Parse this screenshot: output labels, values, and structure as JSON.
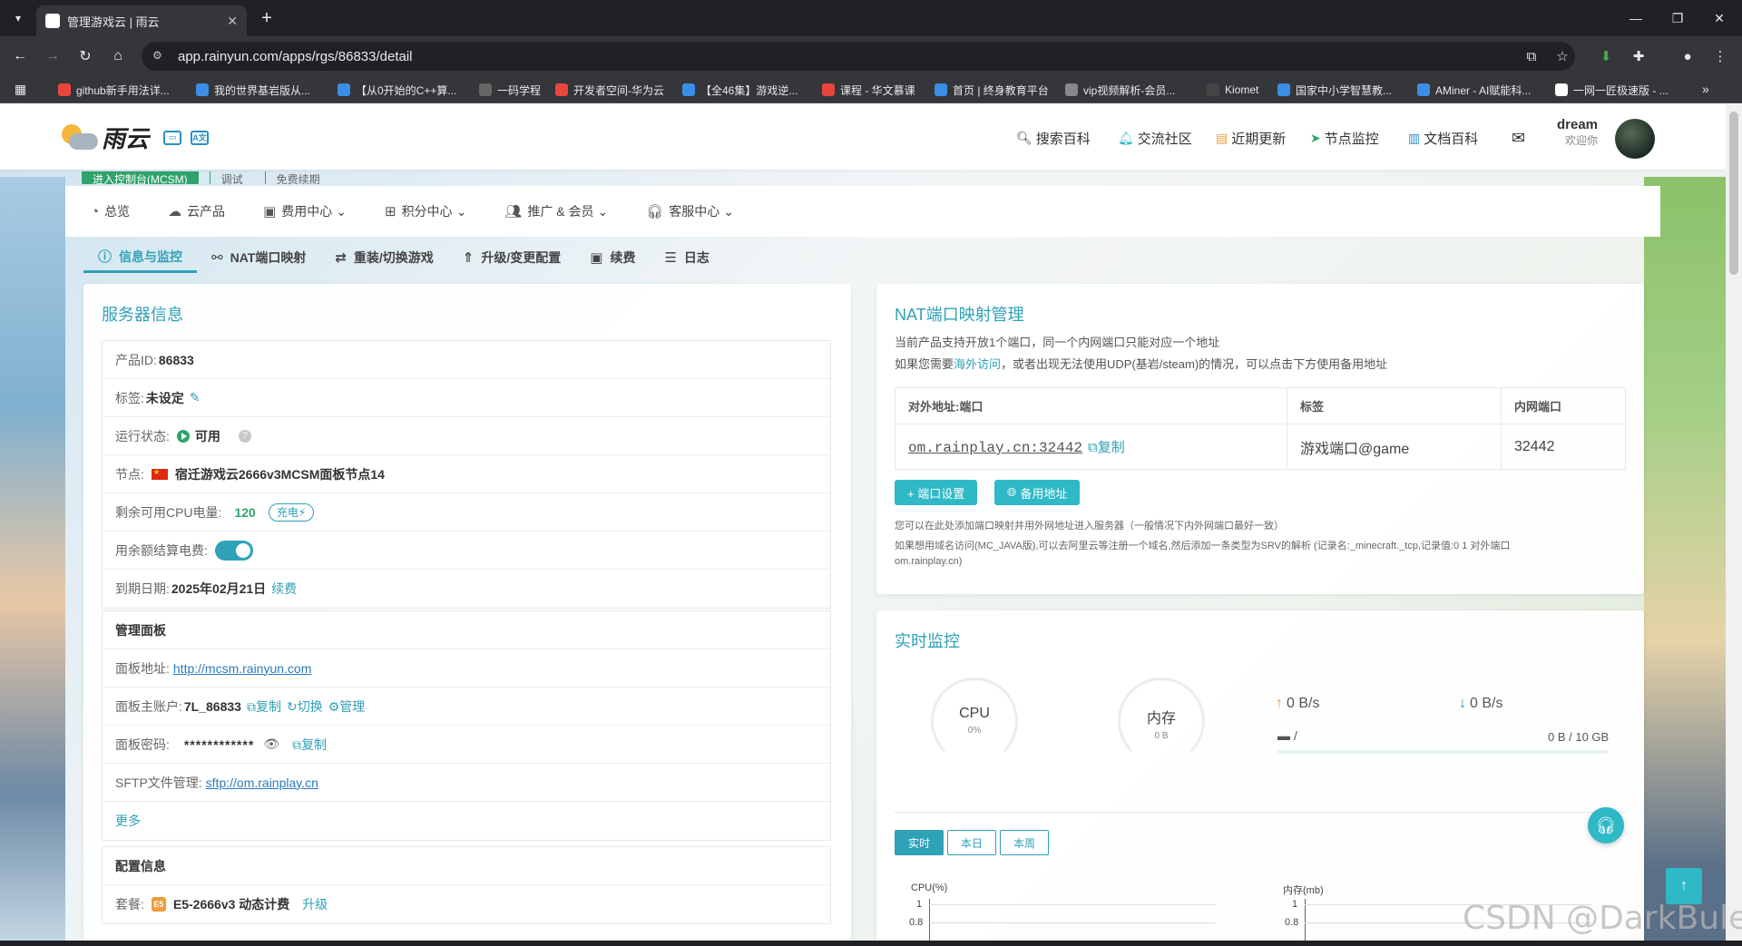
{
  "browser": {
    "tab_title": "管理游戏云 | 雨云",
    "url": "app.rainyun.com/apps/rgs/86833/detail",
    "bookmarks": [
      {
        "label": "github新手用法详...",
        "color": "#e8453c"
      },
      {
        "label": "我的世界基岩版从...",
        "color": "#3b8ee6"
      },
      {
        "label": "【从0开始的C++算...",
        "color": "#3b8ee6"
      },
      {
        "label": "一码学程",
        "color": "#666"
      },
      {
        "label": "开发者空间-华为云",
        "color": "#e8453c"
      },
      {
        "label": "【全46集】游戏逆...",
        "color": "#3b8ee6"
      },
      {
        "label": "课程 - 华文慕课",
        "color": "#e8453c"
      },
      {
        "label": "首页 | 终身教育平台",
        "color": "#3b8ee6"
      },
      {
        "label": "vip视频解析-会员...",
        "color": "#888"
      },
      {
        "label": "Kiomet",
        "color": "#444"
      },
      {
        "label": "国家中小学智慧教...",
        "color": "#3b8ee6"
      },
      {
        "label": "AMiner - AI赋能科...",
        "color": "#3b8ee6"
      },
      {
        "label": "一网一匠极速版 - ...",
        "color": "#fff"
      }
    ]
  },
  "header": {
    "brand": "雨云",
    "nav": [
      {
        "icon": "search-icon",
        "label": "搜索百科"
      },
      {
        "icon": "bell-icon",
        "label": "交流社区"
      },
      {
        "icon": "calendar-icon",
        "label": "近期更新"
      },
      {
        "icon": "send-icon",
        "label": "节点监控"
      },
      {
        "icon": "book-icon",
        "label": "文档百科"
      }
    ],
    "user_name": "dream",
    "user_greeting": "欢迎你"
  },
  "hidden_tabs": {
    "console": "进入控制台(MCSM)",
    "debug": "调试",
    "free_renew": "免费续期"
  },
  "subnav": [
    {
      "icon": "dashboard-icon",
      "label": "总览"
    },
    {
      "icon": "cloud-icon",
      "label": "云产品"
    },
    {
      "icon": "wallet-icon",
      "label": "费用中心"
    },
    {
      "icon": "gift-icon",
      "label": "积分中心"
    },
    {
      "icon": "users-icon",
      "label": "推广 & 会员"
    },
    {
      "icon": "headset-icon",
      "label": "客服中心"
    }
  ],
  "page_tabs": [
    {
      "label": "信息与监控",
      "active": true
    },
    {
      "label": "NAT端口映射"
    },
    {
      "label": "重装/切换游戏"
    },
    {
      "label": "升级/变更配置"
    },
    {
      "label": "续费"
    },
    {
      "label": "日志"
    }
  ],
  "server_info": {
    "title": "服务器信息",
    "product_id_label": "产品ID:",
    "product_id": "86833",
    "tag_label": "标签:",
    "tag": "未设定",
    "status_label": "运行状态:",
    "status": "可用",
    "node_label": "节点:",
    "node": "宿迁游戏云2666v3MCSM面板节点14",
    "cpu_label": "剩余可用CPU电量:",
    "cpu_value": "120",
    "charge": "充电",
    "balance_label": "用余额结算电费:",
    "balance_enabled": true,
    "expire_label": "到期日期:",
    "expire": "2025年02月21日",
    "renew": "续费"
  },
  "panel": {
    "title": "管理面板",
    "url_label": "面板地址:",
    "url": "http://mcsm.rainyun.com",
    "account_label": "面板主账户:",
    "account": "7L_86833",
    "copy": "复制",
    "switch": "切换",
    "manage": "管理",
    "password_label": "面板密码:",
    "password": "************",
    "sftp_label": "SFTP文件管理:",
    "sftp": "sftp://om.rainplay.cn",
    "more": "更多"
  },
  "config": {
    "title": "配置信息",
    "plan_label": "套餐:",
    "plan": "E5-2666v3 动态计费",
    "upgrade": "升级"
  },
  "nat": {
    "title": "NAT端口映射管理",
    "desc1": "当前产品支持开放1个端口，同一个内网端口只能对应一个地址",
    "desc2_pre": "如果您需要",
    "desc2_link": "海外访问",
    "desc2_post": "，或者出现无法使用UDP(基岩/steam)的情况，可以点击下方使用备用地址",
    "headers": [
      "对外地址:端口",
      "标签",
      "内网端口"
    ],
    "rows": [
      {
        "address": "om.rainplay.cn:32442",
        "copy": "复制",
        "tag": "游戏端口@game",
        "port": "32442"
      }
    ],
    "port_settings": "+ 端口设置",
    "backup_address": "备用地址",
    "note1": "您可以在此处添加端口映射并用外网地址进入服务器（一般情况下内外网端口最好一致）",
    "note2": "如果想用域名访问(MC_JAVA版),可以去阿里云等注册一个域名,然后添加一条类型为SRV的解析 (记录名:_minecraft._tcp,记录值:0 1 对外端口",
    "note3": "om.rainplay.cn)"
  },
  "monitor": {
    "title": "实时监控",
    "cpu_label": "CPU",
    "cpu_value": "0%",
    "mem_label": "内存",
    "mem_value": "0 B",
    "upload": "0 B/s",
    "download": "0 B/s",
    "disk_mount": "/",
    "disk_usage": "0 B / 10 GB",
    "disk_fraction": 0,
    "ranges": [
      "实时",
      "本日",
      "本周"
    ],
    "active_range": "实时",
    "cpu_chart_label": "CPU(%)",
    "mem_chart_label": "内存(mb)",
    "ticks": [
      "1",
      "0.8"
    ]
  },
  "watermark": "CSDN @DarkBule_"
}
